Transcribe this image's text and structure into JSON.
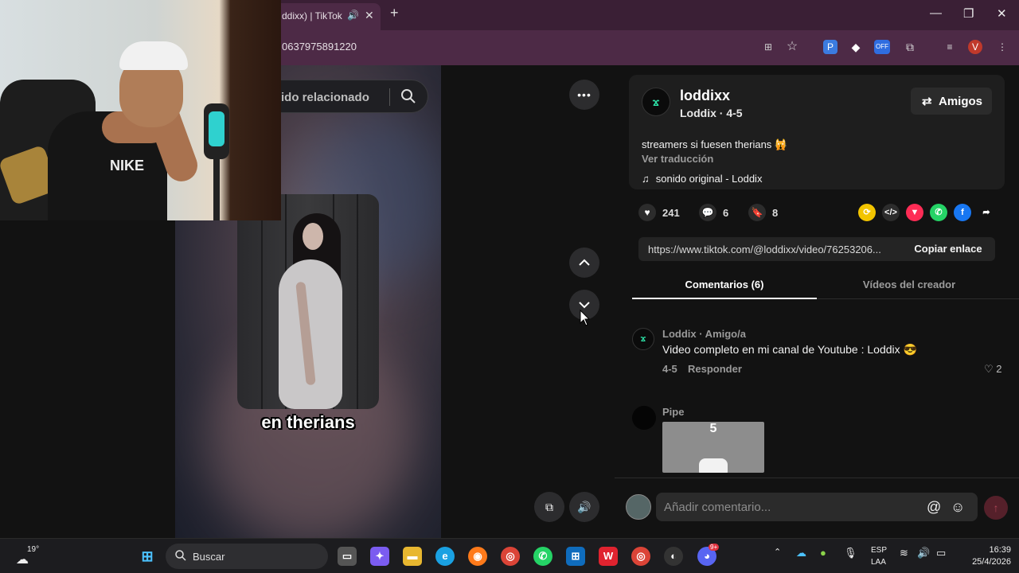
{
  "browser": {
    "tab_title": "ddixx) | TikTok",
    "url": "0637975891220",
    "window_controls": [
      "minimize-icon",
      "restore-icon",
      "close-icon"
    ],
    "extension_badge_off": "OFF"
  },
  "video": {
    "search_text": "ido relacionado",
    "caption": "en therians",
    "more_label": "•••"
  },
  "webcam": {
    "shirt_logo": "NIKE"
  },
  "post": {
    "username": "loddixx",
    "display_name": "Loddix",
    "date": "4-5",
    "subline": "Loddix · 4-5",
    "friends_label": "Amigos",
    "description": "streamers si fuesen therians 🙀",
    "translate_label": "Ver traducción",
    "music": "sonido original - Loddix",
    "likes": "241",
    "comments": "6",
    "saves": "8",
    "link": "https://www.tiktok.com/@loddixx/video/76253206...",
    "copy_label": "Copiar enlace"
  },
  "tabs": {
    "comments": "Comentarios (6)",
    "creator_videos": "Vídeos del creador"
  },
  "comments": [
    {
      "author": "Loddix · Amigo/a",
      "text": "Video completo en mi canal de Youtube : Loddix 😎",
      "date": "4-5",
      "reply_label": "Responder",
      "likes": "2"
    },
    {
      "author": "Pipe",
      "sticker_text": "5"
    }
  ],
  "add_comment": {
    "placeholder": "Añadir comentario..."
  },
  "taskbar": {
    "temperature": "19°",
    "search_label": "Buscar",
    "lang_top": "ESP",
    "lang_bottom": "LAA",
    "time": "16:39",
    "date": "25/4/2026",
    "discord_badge": "9+"
  }
}
